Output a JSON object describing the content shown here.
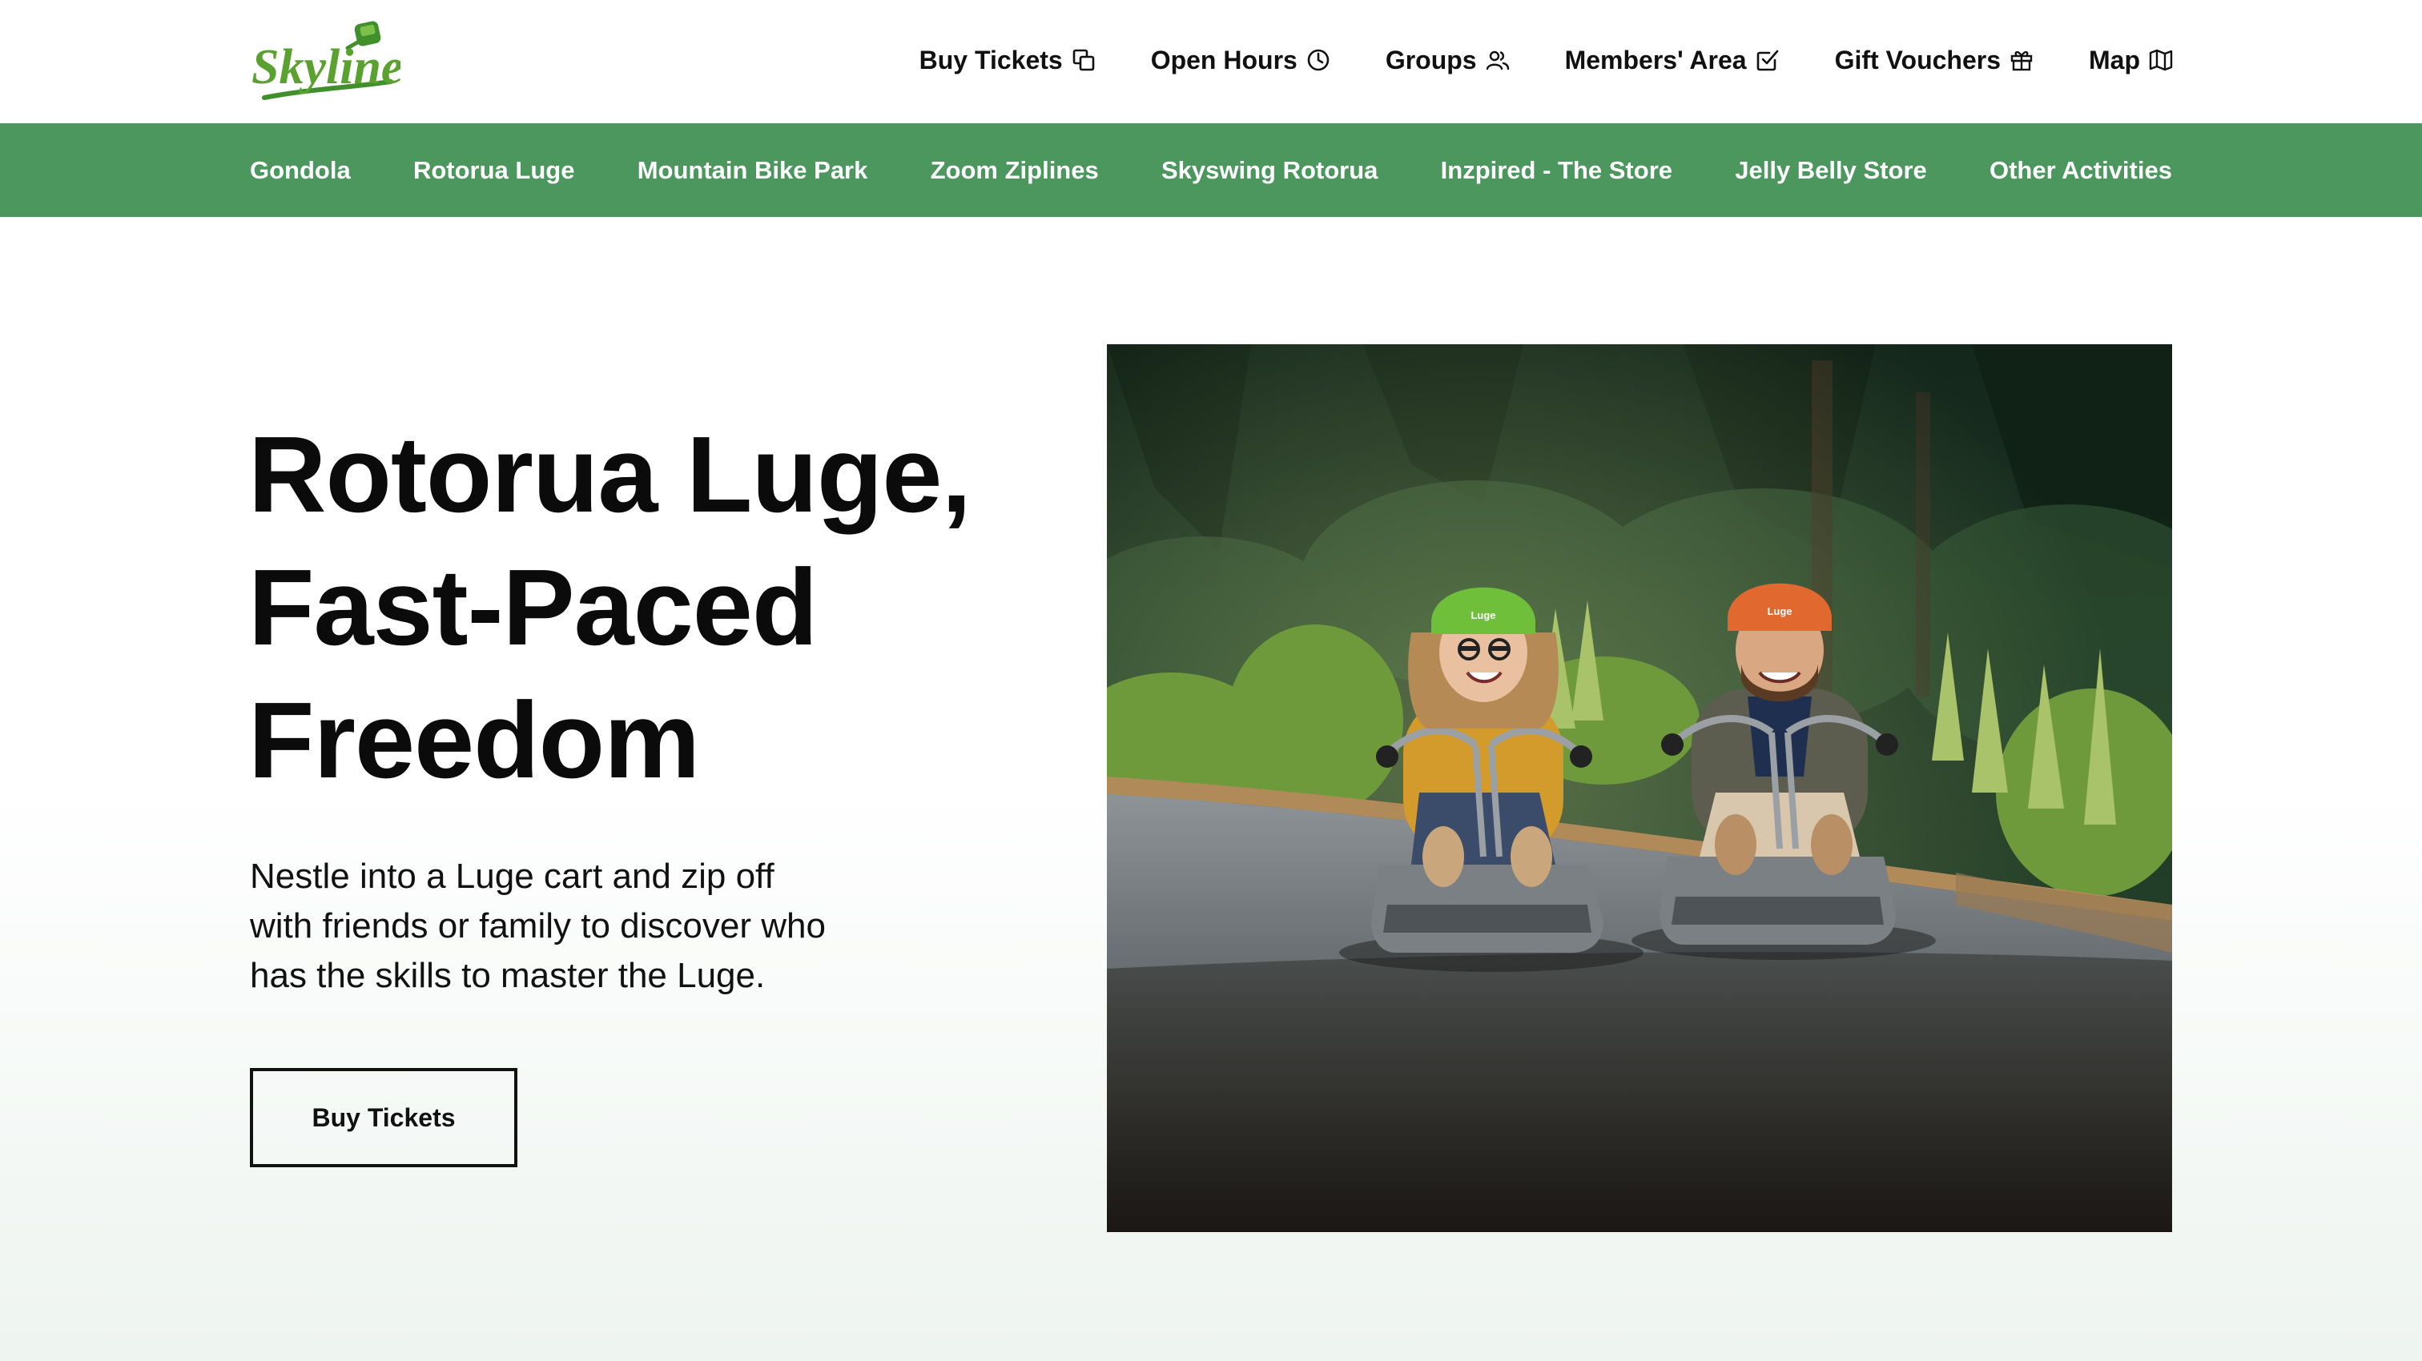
{
  "brand": {
    "logo_text": "Skyline",
    "colors": {
      "green": "#4b975e",
      "logo_green": "#5aa12f",
      "text": "#111111"
    }
  },
  "utility_nav": [
    {
      "label": "Buy Tickets",
      "icon": "tickets-icon"
    },
    {
      "label": "Open Hours",
      "icon": "clock-icon"
    },
    {
      "label": "Groups",
      "icon": "users-icon"
    },
    {
      "label": "Members' Area",
      "icon": "checkbox-icon"
    },
    {
      "label": "Gift Vouchers",
      "icon": "gift-icon"
    },
    {
      "label": "Map",
      "icon": "map-icon"
    }
  ],
  "main_nav": [
    {
      "label": "Gondola"
    },
    {
      "label": "Rotorua Luge"
    },
    {
      "label": "Mountain Bike Park"
    },
    {
      "label": "Zoom Ziplines"
    },
    {
      "label": "Skyswing Rotorua"
    },
    {
      "label": "Inzpired - The Store"
    },
    {
      "label": "Jelly Belly Store"
    },
    {
      "label": "Other Activities"
    }
  ],
  "hero": {
    "title_lines": [
      "Rotorua Luge,",
      "Fast-Paced",
      "Freedom"
    ],
    "description_lines": [
      "Nestle into a Luge cart and zip off",
      "with friends or family to discover who",
      "has the skills to master the Luge."
    ],
    "cta_label": "Buy Tickets"
  },
  "photo": {
    "helmet_text": "Luge"
  }
}
